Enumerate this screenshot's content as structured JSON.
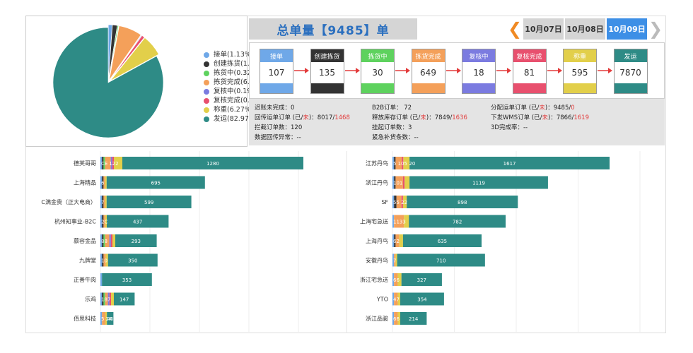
{
  "pie": {
    "legend": [
      {
        "label": "接单(1.13%)",
        "color": "#6fa8e8",
        "value": 1.13
      },
      {
        "label": "创建拣货(1.42%)",
        "color": "#333333",
        "value": 1.42
      },
      {
        "label": "拣货中(0.32%)",
        "color": "#5ed25e",
        "value": 0.32
      },
      {
        "label": "拣货完成(6.84%)",
        "color": "#f4a05a",
        "value": 6.84
      },
      {
        "label": "复核中(0.19%)",
        "color": "#7b7be0",
        "value": 0.19
      },
      {
        "label": "复核完成(0.85%)",
        "color": "#e8506e",
        "value": 0.85
      },
      {
        "label": "称重(6.27%)",
        "color": "#e2cf4a",
        "value": 6.27
      },
      {
        "label": "发运(82.97%)",
        "color": "#2e8b86",
        "value": 82.97
      }
    ]
  },
  "header": {
    "title": "总单量【9485】单",
    "dates": [
      "10月07日",
      "10月08日",
      "10月09日"
    ],
    "active_date_index": 2
  },
  "flow": [
    {
      "label": "接单",
      "value": "107",
      "color": "#6fa8e8"
    },
    {
      "label": "创建拣货",
      "value": "135",
      "color": "#333333"
    },
    {
      "label": "拣货中",
      "value": "30",
      "color": "#5ed25e"
    },
    {
      "label": "拣货完成",
      "value": "649",
      "color": "#f4a05a"
    },
    {
      "label": "复核中",
      "value": "18",
      "color": "#7b7be0"
    },
    {
      "label": "复核完成",
      "value": "81",
      "color": "#e8506e"
    },
    {
      "label": "称重",
      "value": "595",
      "color": "#e2cf4a"
    },
    {
      "label": "发运",
      "value": "7870",
      "color": "#2e8b86"
    }
  ],
  "stats": {
    "s1": "迟账未完成：0",
    "s2_a": "回传运单订单 (已/",
    "s2_b": "未",
    "s2_c": ")：8017/",
    "s2_d": "1468",
    "s3": "拦截订单数：120",
    "s4": "数据回传异常：--",
    "s5": "B2B订单：  72",
    "s6_a": "释放库存订单 (已/",
    "s6_b": "未",
    "s6_c": ")：7849/",
    "s6_d": "1636",
    "s7": "挂起订单数：3",
    "s8": "紧急补货条数：--",
    "s9_a": "分配运单订单 (已/",
    "s9_b": "未",
    "s9_c": ")：9485/",
    "s9_d": "0",
    "s10_a": "下发WMS订单 (已/",
    "s10_b": "未",
    "s10_c": ")：7866/",
    "s10_d": "1619",
    "s11": "3D完成率：--"
  },
  "chart_data": [
    {
      "type": "bar",
      "orientation": "horizontal",
      "stacked": true,
      "categories": [
        "德芙哥哥",
        "上海精品",
        "C满金贵（正大电商）",
        "杭州知事业-B2C",
        "慕容金品",
        "九牌堂",
        "正善牛肉",
        "乐鸡",
        "佰思科技"
      ],
      "series": [
        {
          "color": "#6fa8e8",
          "values": [
            10,
            4,
            4,
            3,
            6,
            3,
            2,
            3,
            2
          ]
        },
        {
          "color": "#333333",
          "values": [
            4,
            2,
            2,
            2,
            10,
            2,
            0,
            2,
            0
          ]
        },
        {
          "color": "#5ed25e",
          "values": [
            2,
            0,
            0,
            0,
            2,
            0,
            0,
            2,
            0
          ]
        },
        {
          "color": "#f4a05a",
          "values": [
            40,
            6,
            6,
            12,
            30,
            16,
            0,
            20,
            24
          ]
        },
        {
          "color": "#7b7be0",
          "values": [
            2,
            0,
            0,
            0,
            2,
            0,
            0,
            2,
            0
          ]
        },
        {
          "color": "#e8506e",
          "values": [
            4,
            0,
            0,
            0,
            4,
            0,
            0,
            10,
            0
          ]
        },
        {
          "color": "#e2cf4a",
          "values": [
            60,
            4,
            4,
            10,
            20,
            16,
            0,
            20,
            6
          ]
        },
        {
          "color": "#2e8b86",
          "values": [
            1280,
            695,
            599,
            437,
            293,
            350,
            353,
            147,
            46
          ]
        }
      ],
      "segment_labels": [
        [
          "CE",
          "122",
          "1280"
        ],
        [
          "6",
          "695"
        ],
        [
          "7",
          "599"
        ],
        [
          "2C",
          "437"
        ],
        [
          "88",
          "293"
        ],
        [
          "10",
          "350"
        ],
        [
          "353"
        ],
        [
          "187",
          "147"
        ],
        [
          "5",
          "24",
          "46"
        ]
      ],
      "xlim": [
        0,
        1400
      ]
    },
    {
      "type": "bar",
      "orientation": "horizontal",
      "stacked": true,
      "categories": [
        "江苏丹鸟",
        "浙江丹鸟",
        "SF",
        "上海宅急送",
        "上海丹鸟",
        "安徽丹鸟",
        "浙江宅急送",
        "YTO",
        "浙江品骏"
      ],
      "series": [
        {
          "color": "#6fa8e8",
          "values": [
            12,
            10,
            8,
            6,
            10,
            4,
            4,
            4,
            4
          ]
        },
        {
          "color": "#333333",
          "values": [
            6,
            6,
            20,
            0,
            4,
            0,
            0,
            0,
            0
          ]
        },
        {
          "color": "#5ed25e",
          "values": [
            0,
            0,
            0,
            0,
            0,
            0,
            0,
            0,
            0
          ]
        },
        {
          "color": "#f4a05a",
          "values": [
            50,
            60,
            40,
            80,
            30,
            10,
            30,
            30,
            30
          ]
        },
        {
          "color": "#7b7be0",
          "values": [
            0,
            0,
            0,
            0,
            0,
            0,
            0,
            0,
            0
          ]
        },
        {
          "color": "#e8506e",
          "values": [
            10,
            4,
            4,
            0,
            0,
            0,
            0,
            0,
            0
          ]
        },
        {
          "color": "#e2cf4a",
          "values": [
            50,
            40,
            30,
            40,
            30,
            10,
            30,
            20,
            20
          ]
        },
        {
          "color": "#2e8b86",
          "values": [
            1617,
            1119,
            898,
            782,
            635,
            710,
            327,
            354,
            214
          ]
        }
      ],
      "segment_labels": [
        [
          "5",
          "105",
          "20",
          "1617"
        ],
        [
          "101",
          "1119"
        ],
        [
          "55",
          "22",
          "898"
        ],
        [
          "1133",
          "782"
        ],
        [
          "62",
          "635"
        ],
        [
          "7",
          "710"
        ],
        [
          "66",
          "327"
        ],
        [
          "47",
          "354"
        ],
        [
          "66",
          "214"
        ]
      ],
      "xlim": [
        0,
        2000
      ]
    }
  ]
}
